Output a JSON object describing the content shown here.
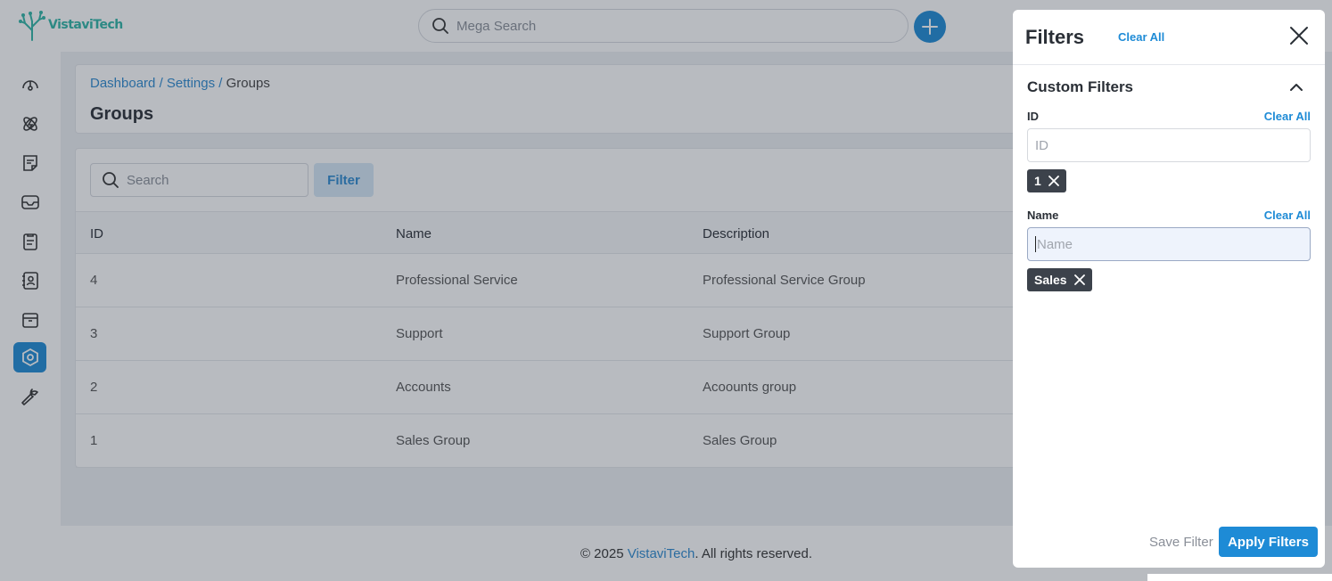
{
  "brand": {
    "name": "VistaviTech"
  },
  "topbar": {
    "search_placeholder": "Mega Search"
  },
  "sidebar": {
    "items": [
      {
        "icon": "dashboard-gauge-icon"
      },
      {
        "icon": "integrations-icon"
      },
      {
        "icon": "notes-icon"
      },
      {
        "icon": "inbox-icon"
      },
      {
        "icon": "clipboard-icon"
      },
      {
        "icon": "contacts-icon"
      },
      {
        "icon": "archive-icon"
      },
      {
        "icon": "settings-icon",
        "active": true
      },
      {
        "icon": "wrench-icon"
      }
    ]
  },
  "breadcrumb": {
    "dashboard": "Dashboard",
    "sep1": "/",
    "settings": "Settings",
    "sep2": "/",
    "current": "Groups"
  },
  "page": {
    "title": "Groups"
  },
  "table": {
    "search_placeholder": "Search",
    "filter_label": "Filter",
    "headers": [
      "ID",
      "Name",
      "Description"
    ],
    "rows": [
      {
        "id": "4",
        "name": "Professional Service",
        "description": "Professional Service Group"
      },
      {
        "id": "3",
        "name": "Support",
        "description": "Support Group"
      },
      {
        "id": "2",
        "name": "Accounts",
        "description": "Acoounts group"
      },
      {
        "id": "1",
        "name": "Sales Group",
        "description": "Sales Group"
      }
    ]
  },
  "footer": {
    "prefix": "© 2025 ",
    "brand": "VistaviTech",
    "suffix": ". All rights reserved."
  },
  "filters_panel": {
    "title": "Filters",
    "clear_all": "Clear All",
    "section_title": "Custom Filters",
    "fields": {
      "id": {
        "label": "ID",
        "clear": "Clear All",
        "placeholder": "ID",
        "chips": [
          "1"
        ]
      },
      "name": {
        "label": "Name",
        "clear": "Clear All",
        "placeholder": "Name",
        "chips": [
          "Sales"
        ]
      }
    },
    "save_label": "Save Filter",
    "apply_label": "Apply Filters"
  },
  "colors": {
    "accent": "#1e8bd6",
    "brand": "#2fb5a6",
    "chip": "#3c424b"
  }
}
